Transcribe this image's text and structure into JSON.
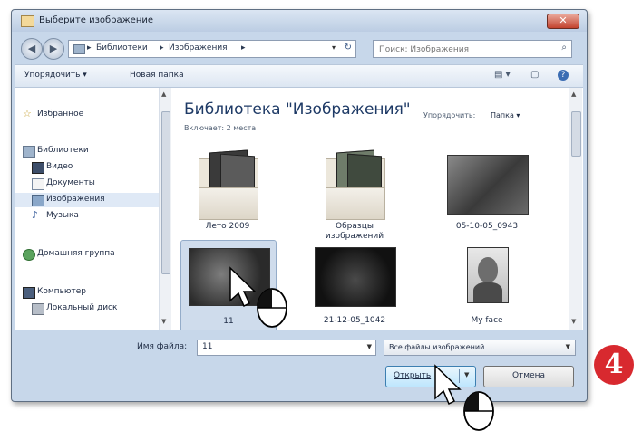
{
  "window": {
    "title": "Выберите изображение",
    "close_glyph": "✕"
  },
  "address_bar": {
    "icon": "library-icon",
    "crumbs": [
      "Библиотеки",
      "Изображения"
    ],
    "separator": "▸",
    "dropdown_glyph": "▾",
    "refresh_glyph": "↻"
  },
  "search": {
    "placeholder": "Поиск: Изображения",
    "icon": "search-icon"
  },
  "toolbar": {
    "organize_label": "Упорядочить ▾",
    "new_folder_label": "Новая папка",
    "view_glyph": "▤ ▾",
    "preview_glyph": "▢",
    "help_glyph": "?"
  },
  "sidebar": {
    "items": [
      {
        "label": "Избранное",
        "icon": "star-icon"
      },
      {
        "label": "Библиотеки",
        "icon": "libraries-icon"
      },
      {
        "label": "Видео",
        "icon": "video-icon"
      },
      {
        "label": "Документы",
        "icon": "documents-icon"
      },
      {
        "label": "Изображения",
        "icon": "pictures-icon",
        "selected": true
      },
      {
        "label": "Музыка",
        "icon": "music-icon"
      },
      {
        "label": "Домашняя группа",
        "icon": "homegroup-icon"
      },
      {
        "label": "Компьютер",
        "icon": "computer-icon"
      },
      {
        "label": "Локальный диск",
        "icon": "disk-icon"
      }
    ]
  },
  "library": {
    "title": "Библиотека \"Изображения\"",
    "includes": "Включает: 2 места",
    "arrange_label": "Упорядочить:",
    "arrange_value": "Папка ▾"
  },
  "files": [
    {
      "name": "Лето 2009",
      "kind": "folder"
    },
    {
      "name": "Образцы изображений",
      "kind": "folder"
    },
    {
      "name": "05-10-05_0943",
      "kind": "photo"
    },
    {
      "name": "11",
      "kind": "photo",
      "selected": true
    },
    {
      "name": "21-12-05_1042",
      "kind": "photo"
    },
    {
      "name": "My face",
      "kind": "photo"
    }
  ],
  "bottom": {
    "file_name_label": "Имя файла:",
    "file_name_value": "11",
    "filter_value": "Все файлы изображений",
    "open_label": "Открыть",
    "cancel_label": "Отмена"
  },
  "step_marker": "4",
  "colors": {
    "accent": "#1e3a66",
    "step": "#d8292f",
    "selection": "#cfdcec"
  }
}
